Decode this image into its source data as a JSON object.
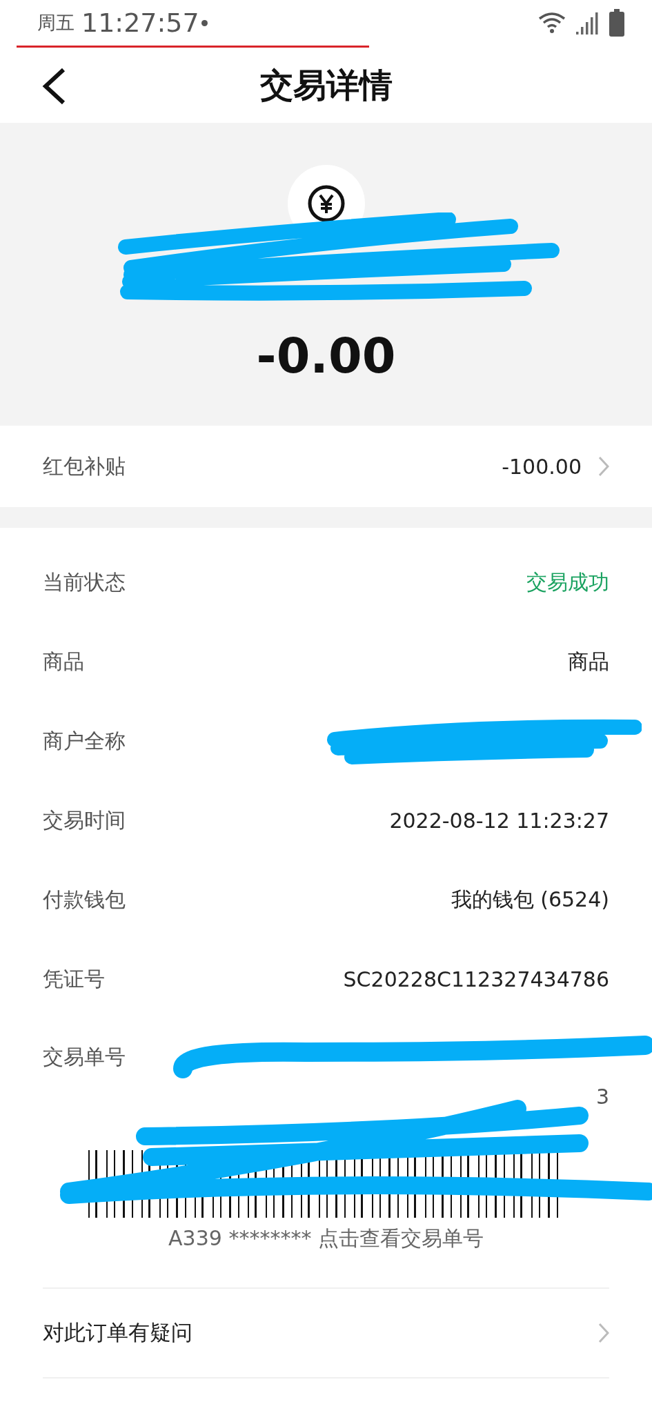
{
  "status_bar": {
    "day": "周五",
    "time": "11:27:57"
  },
  "nav": {
    "title": "交易详情"
  },
  "summary": {
    "amount": "-0.00"
  },
  "subsidy": {
    "label": "红包补贴",
    "value": "-100.00"
  },
  "details": [
    {
      "label": "当前状态",
      "value": "交易成功",
      "kind": "status"
    },
    {
      "label": "商品",
      "value": "商品",
      "kind": "text"
    },
    {
      "label": "商户全称",
      "kind": "redacted"
    },
    {
      "label": "交易时间",
      "value": "2022-08-12 11:23:27",
      "kind": "text"
    },
    {
      "label": "付款钱包",
      "value": "我的钱包 (6524)",
      "kind": "text"
    },
    {
      "label": "凭证号",
      "value": "SC20228C112327434786",
      "kind": "text"
    },
    {
      "label": "交易单号",
      "value": "3",
      "kind": "wrapped"
    }
  ],
  "barcode": {
    "caption": "A339 ******** 点击查看交易单号"
  },
  "question": {
    "label": "对此订单有疑问"
  }
}
